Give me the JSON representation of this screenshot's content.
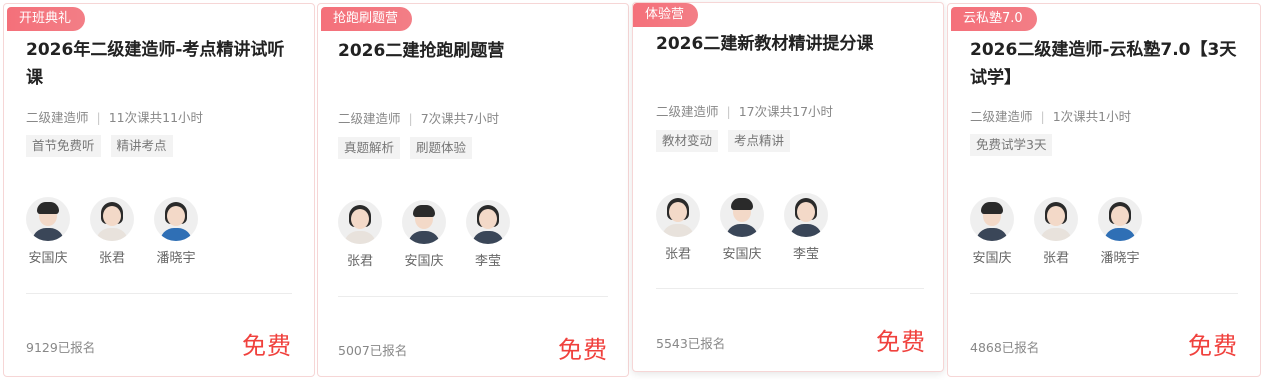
{
  "cards": [
    {
      "badge": "开班典礼",
      "title": "2026年二级建造师-考点精讲试听课",
      "meta_exam": "二级建造师",
      "meta_lessons": "11次课共11小时",
      "tags": [
        "首节免费听",
        "精讲考点"
      ],
      "teachers": [
        "安国庆",
        "张君",
        "潘晓宇"
      ],
      "enrolled": "9129已报名",
      "price": "免费"
    },
    {
      "badge": "抢跑刷题营",
      "title": "2026二建抢跑刷题营",
      "meta_exam": "二级建造师",
      "meta_lessons": "7次课共7小时",
      "tags": [
        "真题解析",
        "刷题体验"
      ],
      "teachers": [
        "张君",
        "安国庆",
        "李莹"
      ],
      "enrolled": "5007已报名",
      "price": "免费"
    },
    {
      "badge": "体验营",
      "title": "2026二建新教材精讲提分课",
      "meta_exam": "二级建造师",
      "meta_lessons": "17次课共17小时",
      "tags": [
        "教材变动",
        "考点精讲"
      ],
      "teachers": [
        "张君",
        "安国庆",
        "李莹"
      ],
      "enrolled": "5543已报名",
      "price": "免费"
    },
    {
      "badge": "云私塾7.0",
      "title": "2026二级建造师-云私塾7.0【3天试学】",
      "meta_exam": "二级建造师",
      "meta_lessons": "1次课共1小时",
      "tags": [
        "免费试学3天"
      ],
      "teachers": [
        "安国庆",
        "张君",
        "潘晓宇"
      ],
      "enrolled": "4868已报名",
      "price": "免费"
    }
  ]
}
